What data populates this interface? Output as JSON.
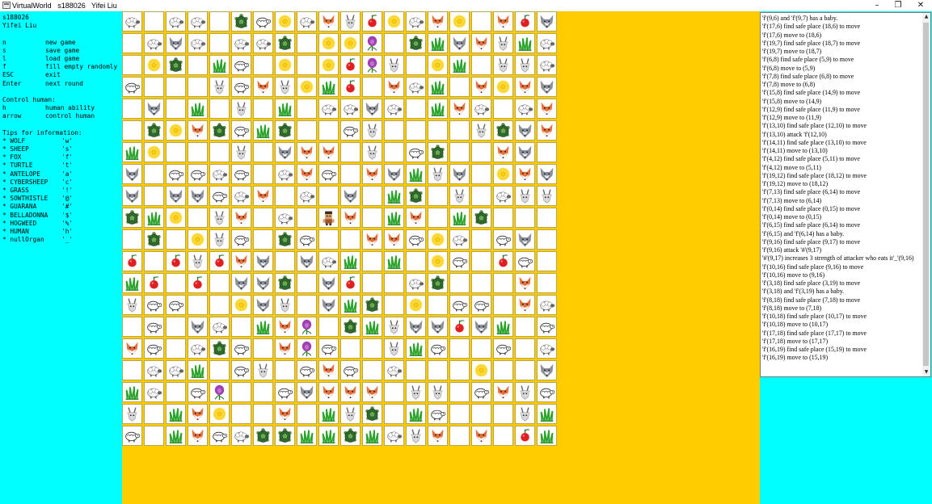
{
  "window": {
    "title": "VirtualWorld   s188026   Yifei Liu",
    "controls": {
      "minimize": "–",
      "maximize": "❐",
      "close": "✕"
    }
  },
  "info": {
    "student_id": "s188026",
    "author": "Yifei Liu",
    "commands": [
      {
        "key": "n",
        "desc": "new game"
      },
      {
        "key": "s",
        "desc": "save game"
      },
      {
        "key": "l",
        "desc": "load game"
      },
      {
        "key": "f",
        "desc": "fill empty randomly"
      },
      {
        "key": "ESC",
        "desc": "exit"
      },
      {
        "key": "Enter",
        "desc": "next round"
      }
    ],
    "control_heading": "Control human:",
    "controls": [
      {
        "key": "h",
        "desc": "human ability"
      },
      {
        "key": "arrow",
        "desc": "control human"
      }
    ],
    "tips_heading": "Tips for information:",
    "tips": [
      {
        "name": "* WOLF",
        "symbol": "'w'"
      },
      {
        "name": "* SHEEP",
        "symbol": "'s'"
      },
      {
        "name": "* FOX",
        "symbol": "'f'"
      },
      {
        "name": "* TURTLE",
        "symbol": "'t'"
      },
      {
        "name": "* ANTELOPE",
        "symbol": "'a'"
      },
      {
        "name": "* CYBERSHEEP",
        "symbol": "'c'"
      },
      {
        "name": "* GRASS",
        "symbol": "'!'"
      },
      {
        "name": "* SOWTHISTLE",
        "symbol": "'@'"
      },
      {
        "name": "* GUARANA",
        "symbol": "'#'"
      },
      {
        "name": "* BELLADONNA",
        "symbol": "'$'"
      },
      {
        "name": "* HOGWEED",
        "symbol": "'%'"
      },
      {
        "name": "* HUMAN",
        "symbol": "'h'"
      },
      {
        "name": "* nullOrgan",
        "symbol": "'_'"
      }
    ]
  },
  "board": {
    "rows": [
      "s_ss_tcSsfaHSsfS_fHw",
      "_sws_sst_SSB_tWwfaWs",
      "_St_Wc_S_SHBa_SW_aas",
      "c___acfaSWH_fsW_fSfw",
      "_w_W_a_W_ssws_Wfs_sf",
      "_tSftcWt__ca____atwf",
      "WS___a_wff_a_ct__fw_",
      "w_ccsc_sfc_fwWaw_Sfw",
      "w_wwcsf_s_w_Wt_a_saa",
      "tWS_af_s_hf_Wf_Wt___",
      "_t_Sac_tc__ffcSs_cw_",
      "H_HaHfw_wsW_W_Sc_Hc_",
      "WH_H_wwt_wH__st___f_",
      "acc__Swa_wWt_S_cc_fs",
      "_c_ws_WfB_tWawwHwW_c",
      "fc_stc_fBc__aWc__c_s",
      "_ssW_ca_cfc_s___S__w",
      "Ws_cB__cwfff_aa_cfac",
      "a_WfS__f_Wat_Wc___aW",
      "c_WfcsttWWtWsaf_f_HW"
    ]
  },
  "colors": {
    "left_panel_bg": "#00FFFF",
    "center_bg": "#FFCC00",
    "right_panel_bg": "#00FFFF"
  },
  "log": [
    "'f'(9,6) and 'f'(9,7) has a baby.",
    "'f'(17,6) find safe place (18,6) to move",
    "'f'(17,6) move to (18,6)",
    "'f'(19,7) find safe place (18,7) to move",
    "'f'(19,7) move to (18,7)",
    "'f'(6,8) find safe place (5,9) to move",
    "'f'(6,8) move to (5,9)",
    "'f'(7,8) find safe place (6,8) to move",
    "'f'(7,8) move to (6,8)",
    "'f'(15,8) find safe place (14,9) to move",
    "'f'(15,8) move to (14,9)",
    "'f'(12,9) find safe place (11,9) to move",
    "'f'(12,9) move to (11,9)",
    "'f'(13,10) find safe place (12,10) to move",
    "'f'(13,10) attack 'f'(12,10)",
    "'f'(14,11) find safe place (13,10) to move",
    "'f'(14,11) move to (13,10)",
    "'f'(4,12) find safe place (5,11) to move",
    "'f'(4,12) move to (5,11)",
    "'f'(19,12) find safe place (18,12) to move",
    "'f'(19,12) move to (18,12)",
    "'f'(7,13) find safe place (6,14) to move",
    "'f'(7,13) move to (6,14)",
    "'f'(0,14) find safe place (0,15) to move",
    "'f'(0,14) move to (0,15)",
    "'f'(6,15) find safe place (6,14) to move",
    "'f'(6,15) and 'f'(6,14) has a baby.",
    "'f'(9,16) find safe place (9,17) to move",
    "'f'(9,16) attack '#'(9,17)",
    "'#'(9,17) increases 3 strength of attacker who eats it'_'(9,16)",
    "'f'(10,16) find safe place (9,16) to move",
    "'f'(10,16) move to (9,16)",
    "'f'(3,18) find safe place (3,19) to move",
    "'f'(3,18) and 'f'(3,19) has a baby.",
    "'f'(8,18) find safe place (7,18) to move",
    "'f'(8,18) move to (7,18)",
    "'f'(10,18) find safe place (10,17) to move",
    "'f'(10,18) move to (10,17)",
    "'f'(17,18) find safe place (17,17) to move",
    "'f'(17,18) move to (17,17)",
    "'f'(16,19) find safe place (15,19) to move",
    "'f'(16,19) move to (15,19)"
  ]
}
